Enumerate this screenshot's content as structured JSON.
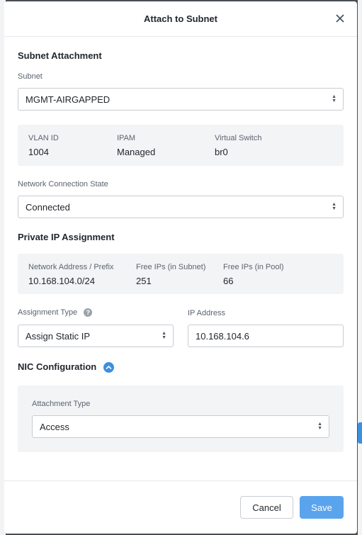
{
  "modal": {
    "title": "Attach to Subnet",
    "close_icon": "close-icon"
  },
  "subnet_attachment": {
    "section_title": "Subnet Attachment",
    "subnet_label": "Subnet",
    "subnet_value": "MGMT-AIRGAPPED",
    "info": {
      "vlan_label": "VLAN ID",
      "vlan_value": "1004",
      "ipam_label": "IPAM",
      "ipam_value": "Managed",
      "vswitch_label": "Virtual Switch",
      "vswitch_value": "br0"
    },
    "connection_state_label": "Network Connection State",
    "connection_state_value": "Connected"
  },
  "private_ip": {
    "section_title": "Private IP Assignment",
    "info": {
      "network_label": "Network Address / Prefix",
      "network_value": "10.168.104.0/24",
      "free_subnet_label": "Free IPs (in Subnet)",
      "free_subnet_value": "251",
      "free_pool_label": "Free IPs (in Pool)",
      "free_pool_value": "66"
    },
    "assignment_type_label": "Assignment Type",
    "assignment_type_value": "Assign Static IP",
    "ip_address_label": "IP Address",
    "ip_address_value": "10.168.104.6"
  },
  "nic": {
    "section_title": "NIC Configuration",
    "attachment_type_label": "Attachment Type",
    "attachment_type_value": "Access"
  },
  "footer": {
    "cancel_label": "Cancel",
    "save_label": "Save"
  },
  "colors": {
    "accent": "#3d8fe0",
    "save_button": "#5aa4ee",
    "info_box": "#f2f4f6"
  }
}
